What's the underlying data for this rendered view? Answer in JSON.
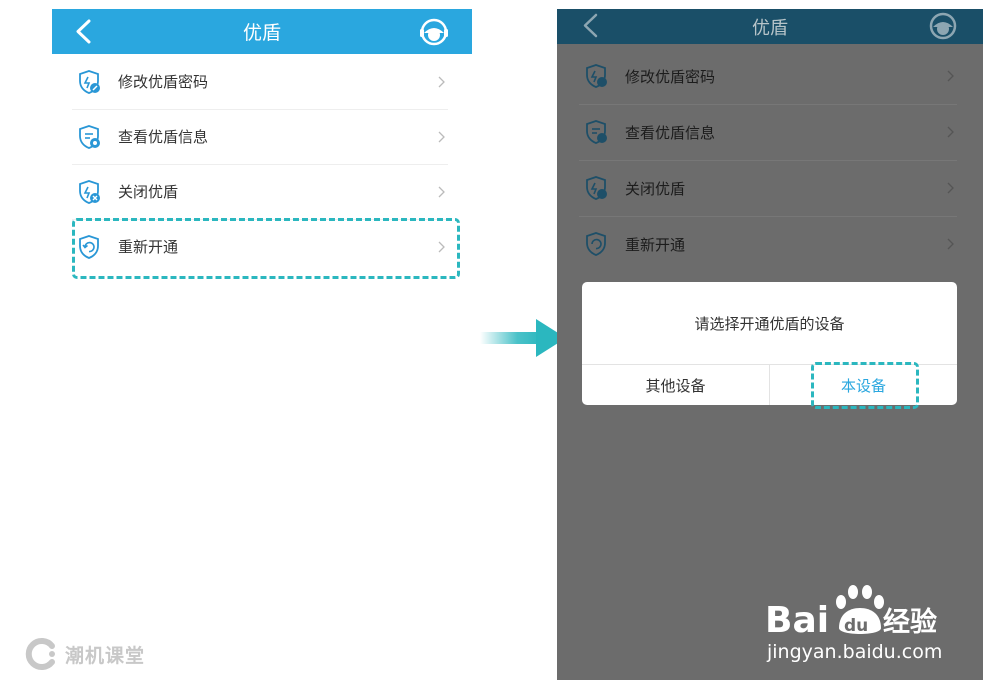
{
  "colors": {
    "topbar_active": "#2aa7df",
    "topbar_dimmed": "#1a4f68",
    "icon_blue": "#2a97d6",
    "highlight": "#2bb7bf",
    "overlay": "#6c6c6c"
  },
  "left_screen": {
    "title": "优盾",
    "back_icon": "chevron-left-icon",
    "support_icon": "customer-service-icon",
    "menu": [
      {
        "label": "修改优盾密码",
        "icon": "shield-edit-icon"
      },
      {
        "label": "查看优盾信息",
        "icon": "shield-info-icon"
      },
      {
        "label": "关闭优盾",
        "icon": "shield-close-icon"
      },
      {
        "label": "重新开通",
        "icon": "shield-reopen-icon"
      }
    ]
  },
  "right_screen": {
    "title": "优盾",
    "menu": [
      {
        "label": "修改优盾密码"
      },
      {
        "label": "查看优盾信息"
      },
      {
        "label": "关闭优盾"
      },
      {
        "label": "重新开通"
      }
    ],
    "dialog": {
      "message": "请选择开通优盾的设备",
      "other_button": "其他设备",
      "this_button": "本设备"
    }
  },
  "watermark": {
    "baidu_text": "Bai",
    "baidu_du": "du",
    "baidu_cn": "经验",
    "baidu_url": "jingyan.baidu.com",
    "chao_text": "潮机课堂"
  }
}
